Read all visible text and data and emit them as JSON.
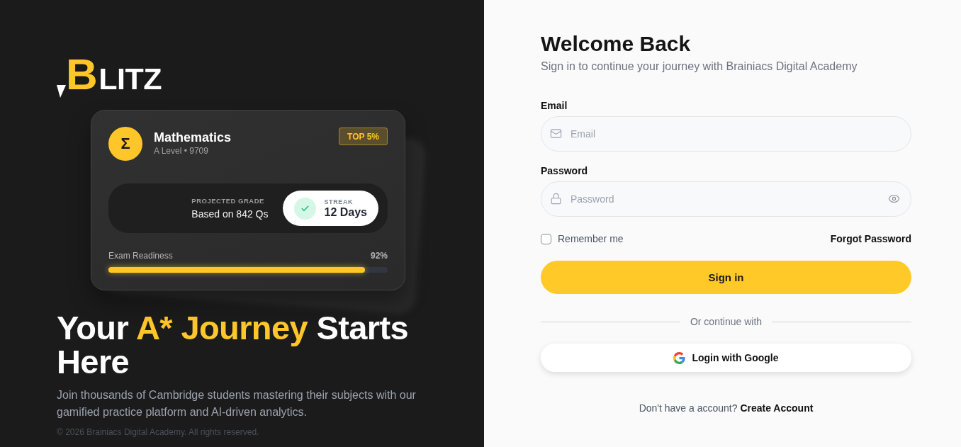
{
  "brand": {
    "accent": "B",
    "rest": "LITZ"
  },
  "subject_card": {
    "icon_glyph": "Σ",
    "title": "Mathematics",
    "subtitle": "A Level • 9709",
    "badge": "TOP 5%",
    "stat_label": "PROJECTED GRADE",
    "stat_value": "Based on 842 Qs",
    "streak": {
      "label": "STREAK",
      "value": "12 Days"
    },
    "readiness": {
      "label": "Exam Readiness",
      "reading": "92%",
      "level": 0.92
    }
  },
  "hero": {
    "headline": {
      "before": "Your",
      "highlight": "A* Journey",
      "after": "Starts Here"
    },
    "description": "Join thousands of Cambridge students mastering their subjects with our gamified practice platform and AI-driven analytics.",
    "copyright": "© 2026 Brainiacs Digital Academy. All rights reserved."
  },
  "form": {
    "title": "Welcome Back",
    "subtitle": "Sign in to continue your journey with Brainiacs Digital Academy",
    "fields": [
      {
        "kind": "email",
        "label": "Email",
        "placeholder": "Email"
      },
      {
        "kind": "password",
        "label": "Password",
        "placeholder": "Password"
      }
    ],
    "remember": {
      "label": "Remember me",
      "checked": false
    },
    "forgot_link": "Forgot Password",
    "submit": "Sign in",
    "divider": "Or continue with",
    "google_button": "Login with Google",
    "signup": {
      "prompt": "Don't have a account?",
      "link": "Create Account"
    }
  }
}
